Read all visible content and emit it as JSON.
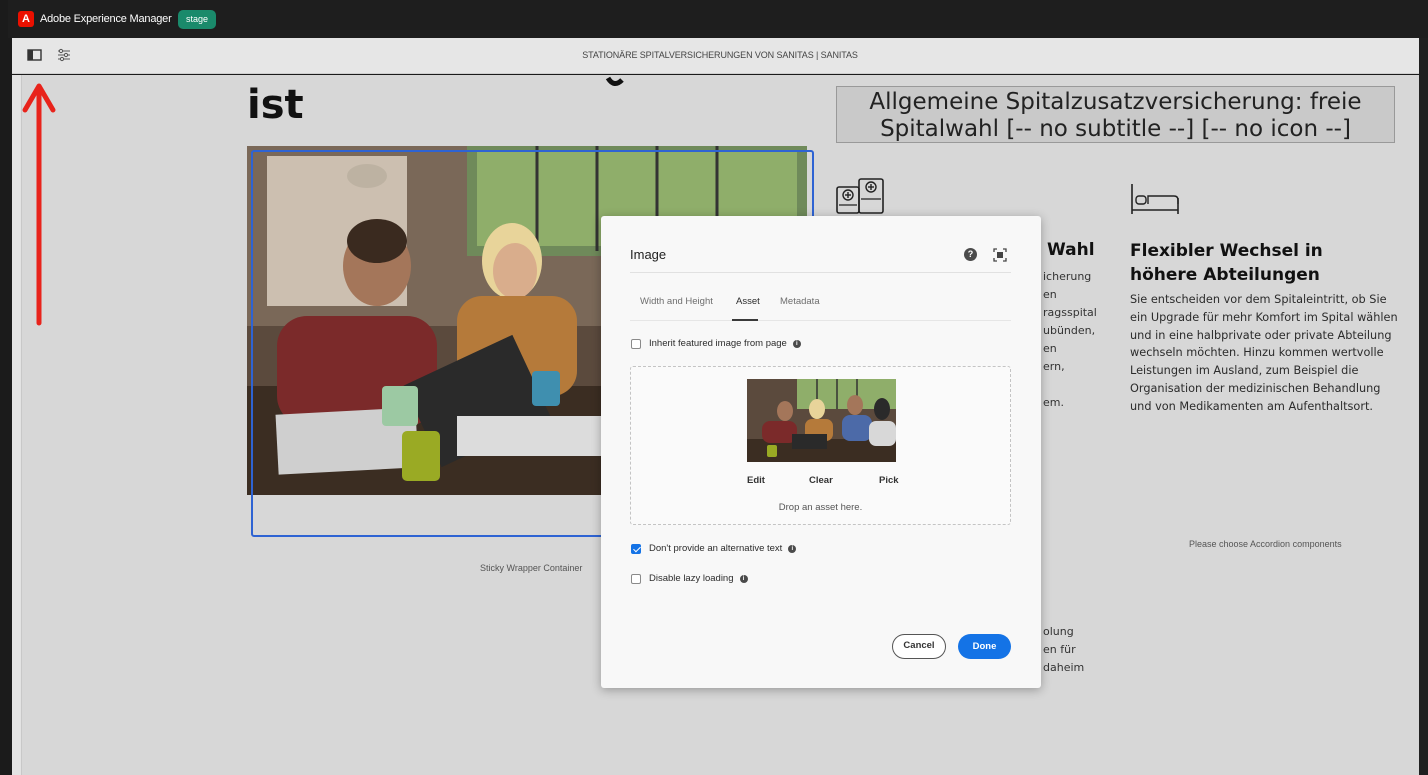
{
  "app": {
    "title": "Adobe Experience Manager",
    "logo_letter": "A",
    "environment_badge": "stage",
    "brand_color": "#eb1000",
    "badge_color": "#1a8a6b"
  },
  "toolbar": {
    "page_name": "STATIONÄRE SPITALVERSICHERUNGEN VON SANITAS | SANITAS",
    "icons": [
      "side-panel-icon",
      "page-properties-icon"
    ]
  },
  "page": {
    "heading_fragment": "ist",
    "sticky_label": "Sticky Wrapper Container",
    "title_box": "Allgemeine Spitalzusatzversicherung: freie Spitalwahl [-- no subtitle --] [-- no icon --]",
    "column1": {
      "heading_fragment": "Wahl",
      "line_fragments": [
        "icherung",
        "en",
        "ragsspital",
        "ubünden,",
        "en",
        "ern,",
        "",
        "em."
      ],
      "bottom_fragments": [
        "olung",
        "en für",
        "daheim"
      ]
    },
    "column2": {
      "title": "Flexibler Wechsel in höhere Abteilungen",
      "body": "Sie entscheiden vor dem Spitaleintritt, ob Sie ein Upgrade für mehr Komfort im Spital wählen und in eine halbprivate oder private Abteilung wechseln möchten. Hinzu kommen wertvolle Leistungen im Ausland, zum Beispiel die Organisation der medizinischen Behandlung und von Medikamenten am Aufenthaltsort.",
      "accordion_note": "Please choose Accordion components"
    }
  },
  "dialog": {
    "title": "Image",
    "tabs": [
      {
        "label": "Width and Height",
        "active": false
      },
      {
        "label": "Asset",
        "active": true
      },
      {
        "label": "Metadata",
        "active": false
      }
    ],
    "inherit_featured": {
      "label": "Inherit featured image from page",
      "checked": false
    },
    "dropzone": {
      "edit_label": "Edit",
      "clear_label": "Clear",
      "pick_label": "Pick",
      "drop_text": "Drop an asset here."
    },
    "no_alt_text": {
      "label": "Don't provide an alternative text",
      "checked": true
    },
    "disable_lazy": {
      "label": "Disable lazy loading",
      "checked": false
    },
    "cancel_label": "Cancel",
    "done_label": "Done",
    "accent_color": "#1473e6"
  }
}
